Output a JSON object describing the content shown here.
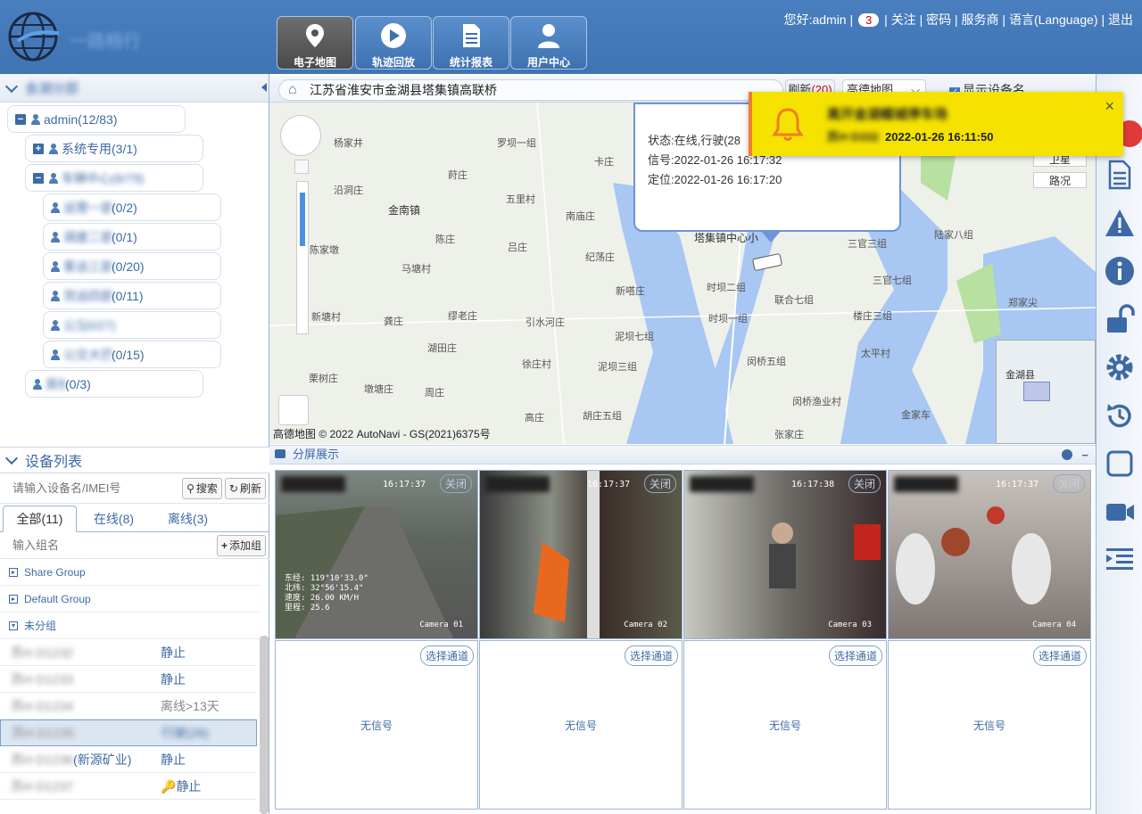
{
  "header": {
    "logo_text": "一路畅行",
    "nav": [
      {
        "label": "电子地图",
        "icon": "map-pin-icon",
        "active": true
      },
      {
        "label": "轨迹回放",
        "icon": "play-icon",
        "active": false
      },
      {
        "label": "统计报表",
        "icon": "report-icon",
        "active": false
      },
      {
        "label": "用户中心",
        "icon": "user-icon",
        "active": false
      }
    ],
    "user": {
      "greeting": "您好:admin",
      "badge": "3",
      "links": [
        "关注",
        "密码",
        "服务商",
        "语言(Language)",
        "退出"
      ]
    }
  },
  "org_panel": {
    "title": "金湖分部",
    "nodes": [
      {
        "label": "admin(12/83)",
        "toggle": "−"
      },
      {
        "label": "系统专用(3/1)",
        "toggle": "+"
      },
      {
        "label": "车辆中心(6/79)",
        "toggle": "−"
      },
      {
        "label": "(0/2)",
        "blur_prefix": "运营一部"
      },
      {
        "label": "(0/1)",
        "blur_prefix": "调度二部"
      },
      {
        "label": "(0/20)",
        "blur_prefix": "客运三部"
      },
      {
        "label": "(0/11)",
        "blur_prefix": "货运四部"
      },
      {
        "label": "(0/27)",
        "blur_prefix": "公交"
      },
      {
        "label": "(0/15)",
        "blur_prefix": "公交大巴"
      },
      {
        "label": "(0/3)",
        "blur_prefix": "其他"
      }
    ]
  },
  "device_panel": {
    "title": "设备列表",
    "search_placeholder": "请输入设备名/IMEI号",
    "search_btn": "搜索",
    "refresh_btn": "刷新",
    "tabs": [
      "全部(11)",
      "在线(8)",
      "离线(3)"
    ],
    "group_placeholder": "输入组名",
    "add_group_btn": "添加组",
    "groups": [
      "Share Group",
      "Default Group",
      "未分组"
    ],
    "devices": [
      {
        "name": "苏H·D1232",
        "status": "静止"
      },
      {
        "name": "苏H·D1233",
        "status": "静止"
      },
      {
        "name": "苏H·D1234",
        "status": "离线>13天"
      },
      {
        "name": "苏H·D1235",
        "status": "行驶(26)"
      },
      {
        "name": "苏H·D1236",
        "name_tail": "(新源矿业)",
        "status": "静止"
      },
      {
        "name": "苏H·D1237",
        "status": "静止"
      }
    ]
  },
  "address_bar": {
    "address": "江苏省淮安市金湖县塔集镇高联桥",
    "refresh_label": "刷新",
    "refresh_count": "(20)",
    "map_type": "高德地图",
    "show_name_label": "显示设备名"
  },
  "map": {
    "labels": [
      "杨家井",
      "罗坝一组",
      "卡庄",
      "沿洞庄",
      "金南镇",
      "莳庄",
      "五里村",
      "南庙庄",
      "陈家墩",
      "陈庄",
      "吕庄",
      "纪荡庄",
      "马塘村",
      "新嗒庄",
      "时坝二组",
      "联合七组",
      "新塘村",
      "龚庄",
      "缪老庄",
      "引水河庄",
      "泥坝七组",
      "时坝一组",
      "湖田庄",
      "徐庄村",
      "泥坝三组",
      "闵桥五组",
      "栗树庄",
      "墩塘庄",
      "周庄",
      "高庄",
      "胡庄五组",
      "闵桥渔业村",
      "塔集镇中心小",
      "三官三组",
      "三官七组",
      "陆家八组",
      "郑家尖",
      "楼庄三组",
      "太平村",
      "金家车",
      "张家庄",
      "金湖县",
      "卫星",
      "路况"
    ],
    "popup": {
      "status": "状态:在线,行驶(28",
      "signal": "信号:2022-01-26 16:17:32",
      "location": "定位:2022-01-26 16:17:20"
    },
    "copyright": "© 2022 AutoNavi - GS(2021)6375号",
    "brand": "高德地图"
  },
  "alert": {
    "title": "离开金湖蝶城停车场",
    "plate": "苏H·D332",
    "time": "2022-01-26 16:11:50",
    "close": "×"
  },
  "split_screen": {
    "title": "分屏展示",
    "cameras": [
      {
        "time": "16:17:37",
        "label": "Camera 01",
        "close": "关闭",
        "overlay": [
          "东经: 119°10'33.0\"",
          "北纬: 32°56'15.4\"",
          "速度: 26.00 KM/H",
          "里程: 25.6"
        ]
      },
      {
        "time": "16:17:37",
        "label": "Camera 02",
        "close": "关闭"
      },
      {
        "time": "16:17:38",
        "label": "Camera 03",
        "close": "关闭"
      },
      {
        "time": "16:17:37",
        "label": "Camera 04",
        "close": "关闭"
      }
    ],
    "empty_cells": [
      {
        "select": "选择通道",
        "status": "无信号"
      },
      {
        "select": "选择通道",
        "status": "无信号"
      },
      {
        "select": "选择通道",
        "status": "无信号"
      },
      {
        "select": "选择通道",
        "status": "无信号"
      }
    ]
  },
  "right_toolbar": [
    "document-icon",
    "warning-icon",
    "info-icon",
    "unlock-icon",
    "gear-icon",
    "history-icon",
    "square-icon",
    "video-icon",
    "list-indent-icon"
  ]
}
